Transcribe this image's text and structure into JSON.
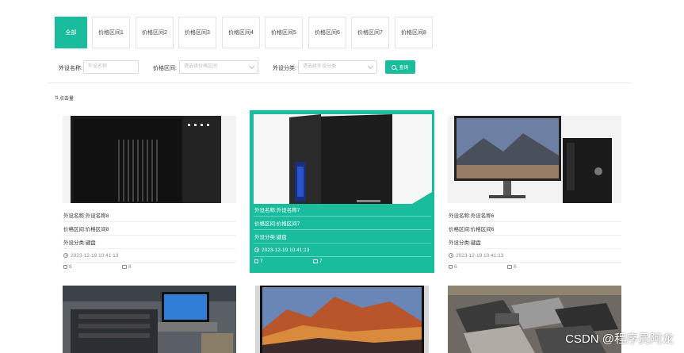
{
  "tabs": {
    "items": [
      "全部",
      "价格区间1",
      "价格区间2",
      "价格区间3",
      "价格区间4",
      "价格区间5",
      "价格区间6",
      "价格区间7",
      "价格区间8"
    ],
    "active_index": 0
  },
  "search": {
    "name_label": "外设名称:",
    "name_placeholder": "外设名称",
    "price_label": "价格区间:",
    "price_placeholder": "请选择价格区间",
    "category_label": "外设分类:",
    "category_placeholder": "请选择外设分类",
    "button_label": "查询"
  },
  "sort": {
    "icon": "sort-icon",
    "label": "点击量"
  },
  "cards": [
    {
      "name": "外设名称:外设名称8",
      "price": "价格区间:价格区间8",
      "category": "外设分类:键盘",
      "time": "2023-12-19 10:41:13",
      "likes": "8",
      "comments": "8",
      "image": "black-pc-tower"
    },
    {
      "name": "外设名称:外设名称7",
      "price": "价格区间:价格区间7",
      "category": "外设分类:键盘",
      "time": "2023-12-19 10:41:13",
      "likes": "7",
      "comments": "7",
      "image": "gaming-pc-tower"
    },
    {
      "name": "外设名称:外设名称6",
      "price": "价格区间:价格区间6",
      "category": "外设分类:键盘",
      "time": "2023-12-19 10:41:13",
      "likes": "6",
      "comments": "6",
      "image": "monitor-and-pc"
    },
    {
      "image": "laptops-in-warehouse"
    },
    {
      "image": "imac-mountain-wallpaper"
    },
    {
      "image": "pile-of-old-laptops"
    }
  ],
  "colors": {
    "accent": "#19bc9c"
  },
  "watermark": "CSDN @程序员阿龙"
}
